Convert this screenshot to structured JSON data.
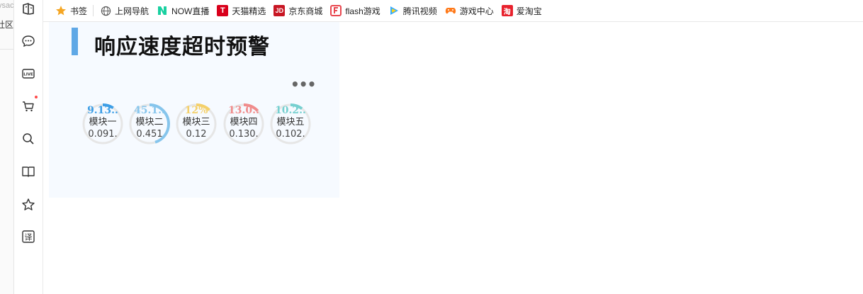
{
  "left_fragment": {
    "line1": "ysac",
    "line2": "社区"
  },
  "bookmarks": [
    {
      "label": "书签",
      "icon": "star-icon",
      "color": "#f5a623"
    },
    {
      "label": "上网导航",
      "icon": "globe-icon",
      "color": "#555555"
    },
    {
      "label": "NOW直播",
      "icon": "now-live-icon",
      "color": "#19d0a0"
    },
    {
      "label": "天猫精选",
      "icon": "tmall-icon",
      "color": "#d9001b"
    },
    {
      "label": "京东商城",
      "icon": "jd-icon",
      "color": "#c81623"
    },
    {
      "label": "flash游戏",
      "icon": "flash-game-icon",
      "color": "#e8474f"
    },
    {
      "label": "腾讯视频",
      "icon": "tencent-video-icon",
      "color": "#33aaff"
    },
    {
      "label": "游戏中心",
      "icon": "gamepad-icon",
      "color": "#ff7a1a"
    },
    {
      "label": "爱淘宝",
      "icon": "taobao-icon",
      "color": "#e8222d"
    }
  ],
  "panel": {
    "title": "响应速度超时预警",
    "more_label": "•••",
    "accent": "#5fa8e6",
    "modules": [
      {
        "name": "模块一",
        "percent": "9.13..",
        "value": "0.091.",
        "color": "#3d9ee6",
        "fraction": 0.0913
      },
      {
        "name": "模块二",
        "percent": "45.1..",
        "value": "0.451",
        "color": "#86c5ec",
        "fraction": 0.451
      },
      {
        "name": "模块三",
        "percent": "12%",
        "value": "0.12",
        "color": "#f4d06a",
        "fraction": 0.12
      },
      {
        "name": "模块四",
        "percent": "13.0..",
        "value": "0.130.",
        "color": "#f08c8c",
        "fraction": 0.13
      },
      {
        "name": "模块五",
        "percent": "10.2..",
        "value": "0.102.",
        "color": "#76d0d0",
        "fraction": 0.102
      }
    ]
  }
}
